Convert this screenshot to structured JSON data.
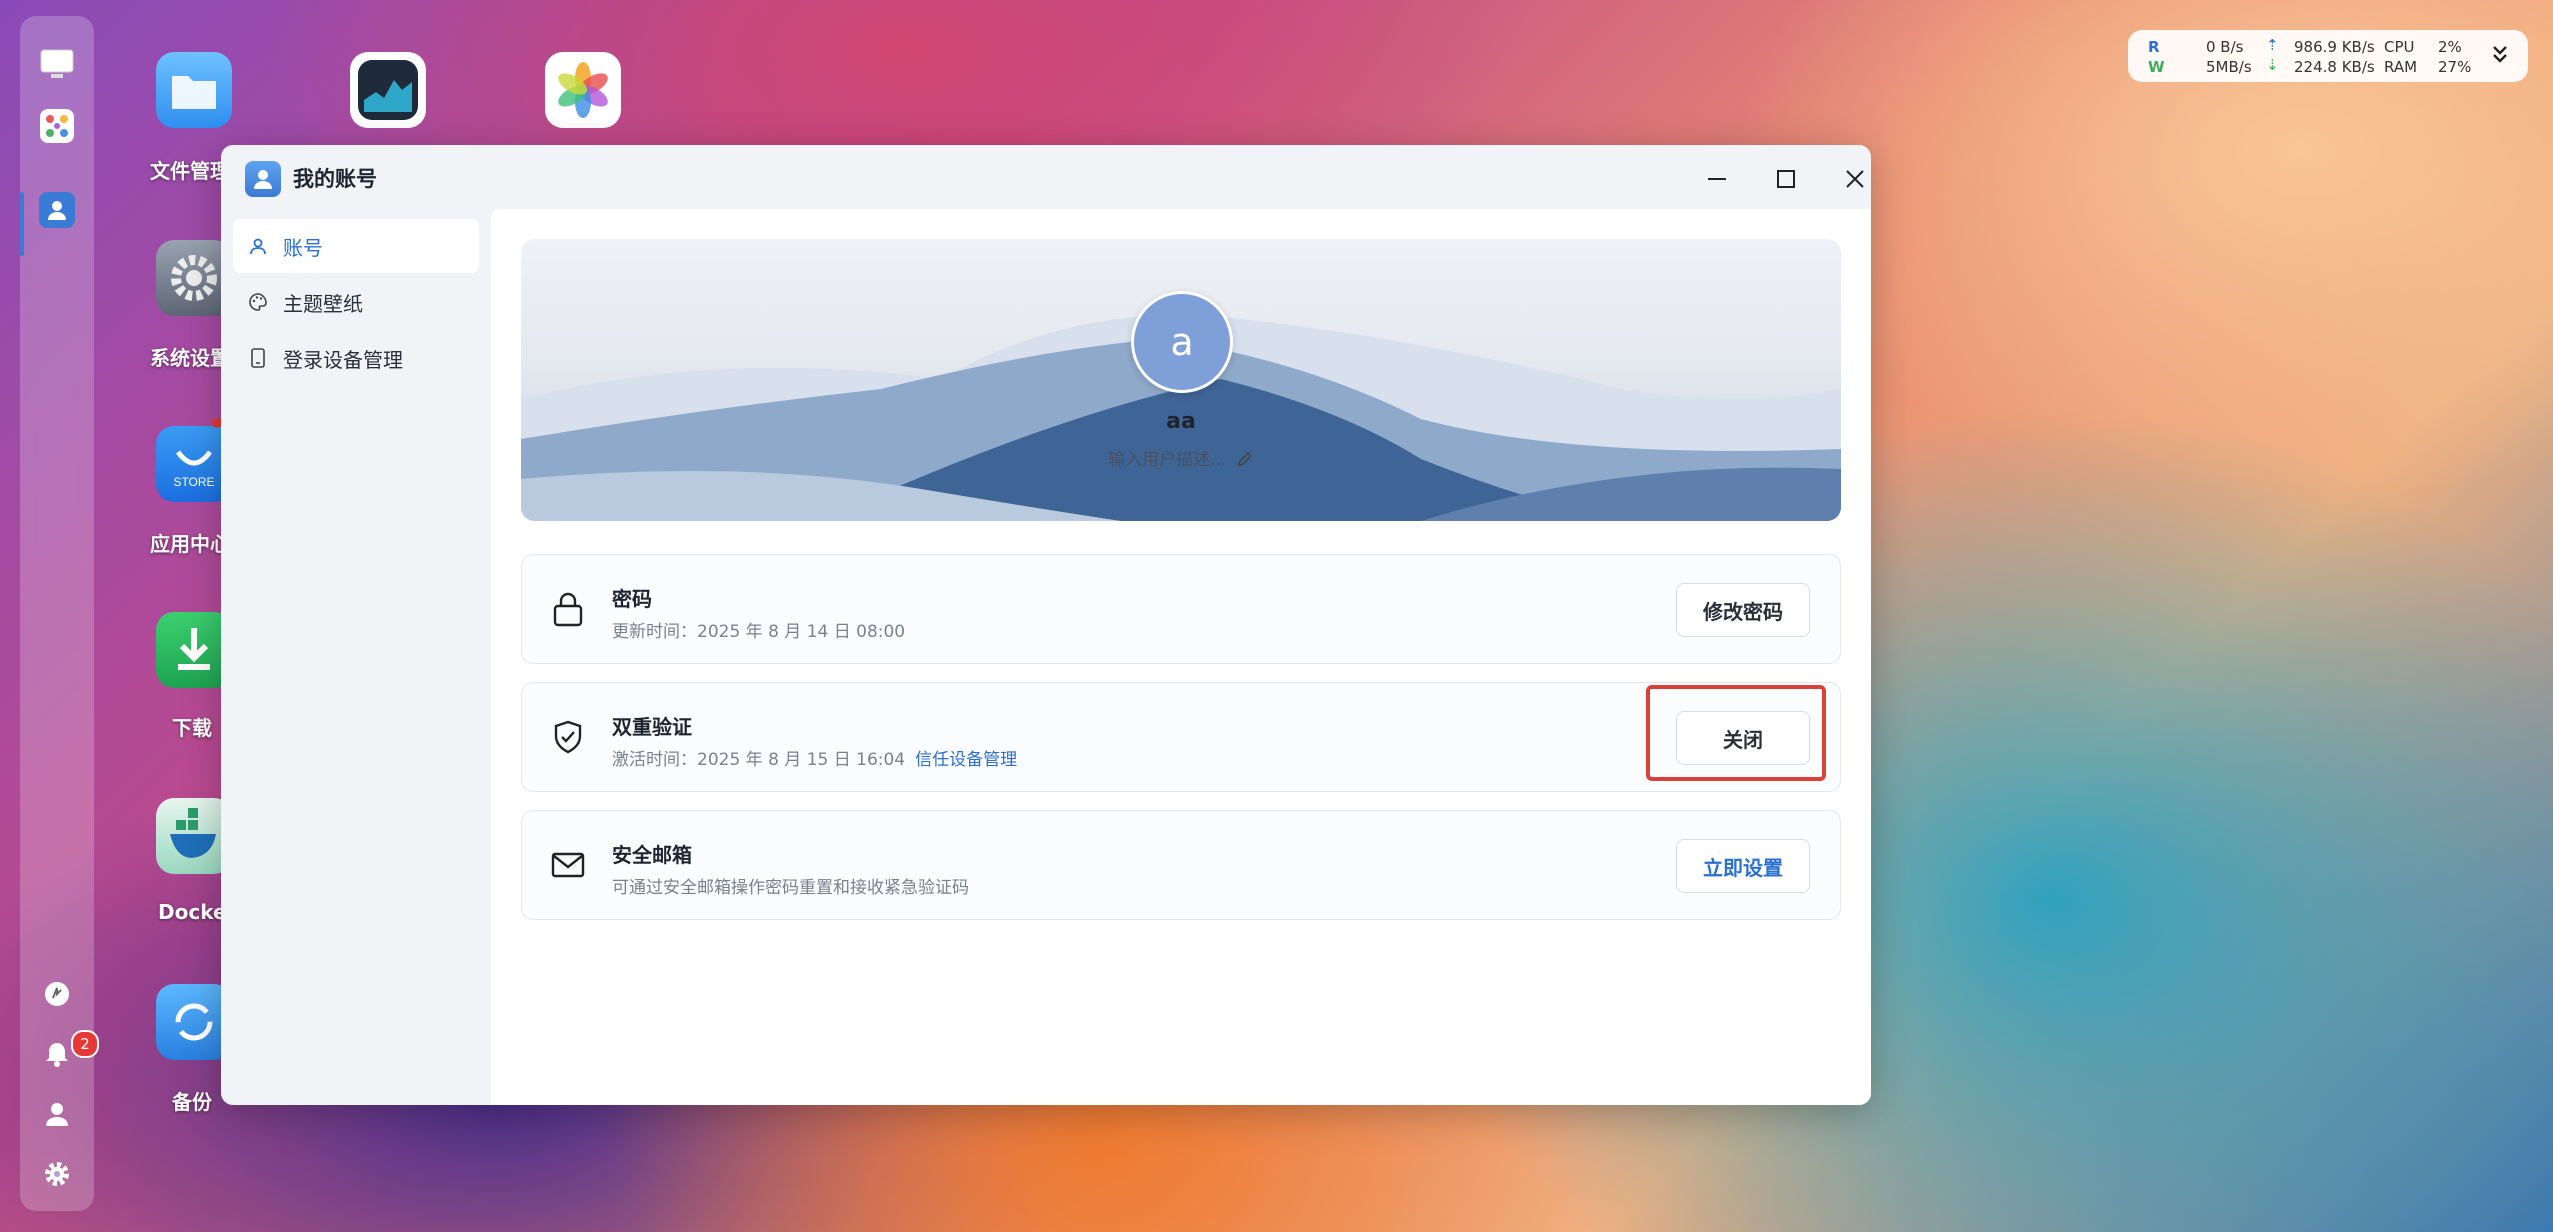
{
  "desktop": {
    "icons": [
      {
        "name": "folder-icon",
        "label": "文件管理"
      },
      {
        "name": "activity-monitor-icon",
        "label": ""
      },
      {
        "name": "photos-icon",
        "label": ""
      },
      {
        "name": "settings-icon",
        "label": "系统设置"
      },
      {
        "name": "store-icon",
        "label": "应用中心",
        "badge_text": "STORE"
      },
      {
        "name": "download-icon",
        "label": "下载"
      },
      {
        "name": "docker-icon",
        "label": "Docker"
      },
      {
        "name": "backup-icon",
        "label": "备份"
      }
    ]
  },
  "dock": {
    "notification_count": "2"
  },
  "sysinfo": {
    "r_label": "R",
    "w_label": "W",
    "r_rate": "0  B/s",
    "w_rate": "5MB/s",
    "up_rate": "986.9 KB/s",
    "down_rate": "224.8 KB/s",
    "cpu_label": "CPU",
    "ram_label": "RAM",
    "cpu_value": "2%",
    "ram_value": "27%"
  },
  "window": {
    "title": "我的账号",
    "sidebar": [
      {
        "label": "账号",
        "active": true
      },
      {
        "label": "主题壁纸",
        "active": false
      },
      {
        "label": "登录设备管理",
        "active": false
      }
    ],
    "profile": {
      "avatar_letter": "a",
      "username": "aa",
      "description_placeholder": "输入用户描述..."
    },
    "cards": [
      {
        "title": "密码",
        "subtitle": "更新时间：2025 年 8 月 14 日 08:00",
        "link": "",
        "button": "修改密码"
      },
      {
        "title": "双重验证",
        "subtitle": "激活时间：2025 年 8 月 15 日 16:04",
        "link": "信任设备管理",
        "button": "关闭"
      },
      {
        "title": "安全邮箱",
        "subtitle": "可通过安全邮箱操作密码重置和接收紧急验证码",
        "link": "",
        "button": "立即设置"
      }
    ]
  },
  "colors": {
    "accent": "#2a6fd1",
    "highlight": "#d9403a",
    "badge": "#e53935"
  }
}
